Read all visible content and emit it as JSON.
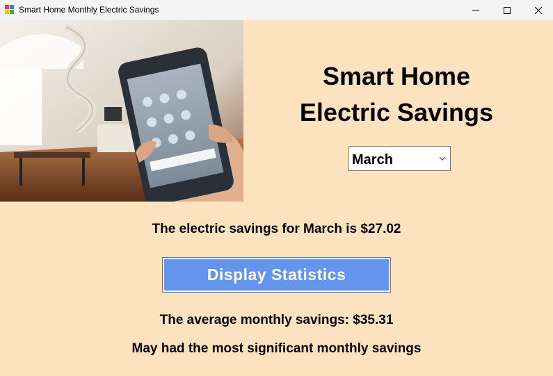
{
  "window": {
    "title": "Smart Home Monthly Electric Savings",
    "controls": [
      "minimize-icon",
      "maximize-icon",
      "close-icon"
    ]
  },
  "header": {
    "line1": "Smart Home",
    "line2": "Electric Savings"
  },
  "month_select": {
    "selected": "March"
  },
  "results": {
    "month_savings": "The electric savings for March is $27.02",
    "average": "The average monthly savings: $35.31",
    "most_significant": "May had the most significant monthly savings"
  },
  "buttons": {
    "display_statistics": "Display Statistics"
  },
  "colors": {
    "background": "#fde2c0",
    "button": "#6495ed"
  }
}
